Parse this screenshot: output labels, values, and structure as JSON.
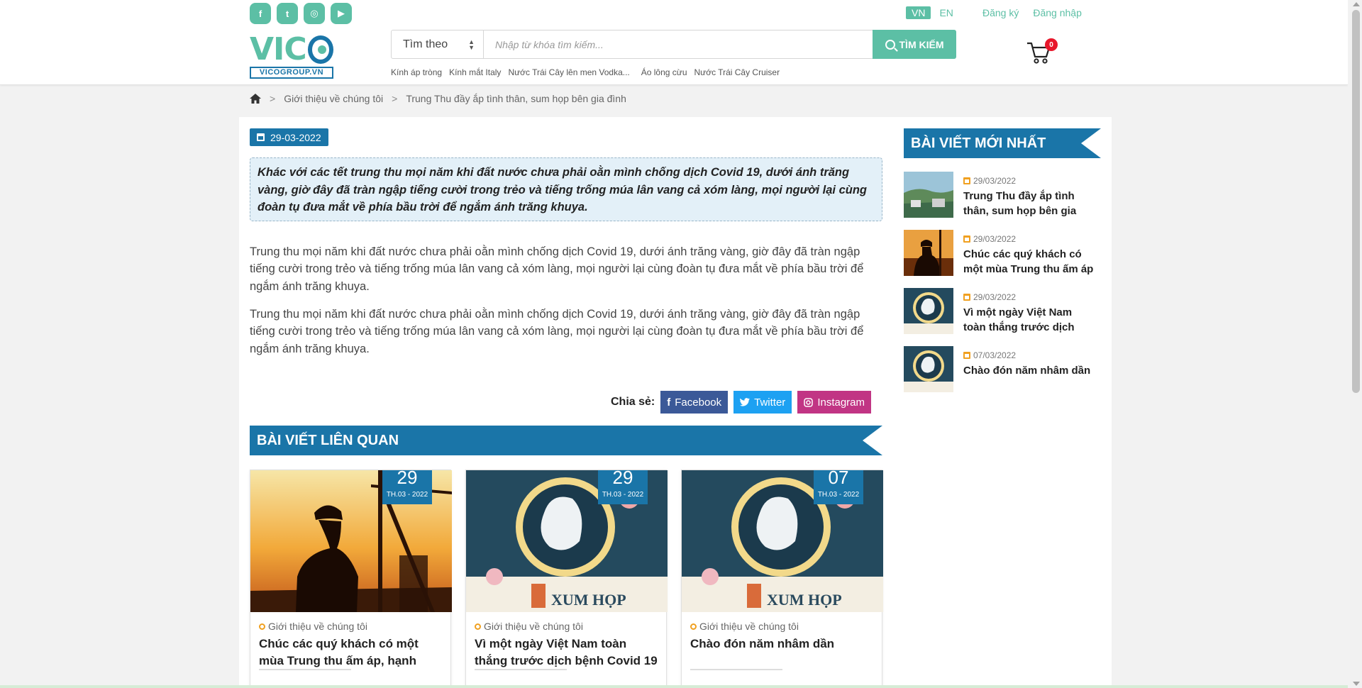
{
  "header": {
    "socials": [
      {
        "name": "facebook-icon",
        "glyph": "f"
      },
      {
        "name": "twitter-icon",
        "glyph": "t"
      },
      {
        "name": "instagram-icon",
        "glyph": "◎"
      },
      {
        "name": "youtube-icon",
        "glyph": "▶"
      }
    ],
    "logo_word": "VIC",
    "logo_sub": "VICOGROUP.VN",
    "search": {
      "select_label": "Tìm theo",
      "placeholder": "Nhập từ khóa tìm kiếm...",
      "button_label": "TÌM KIẾM"
    },
    "keywords": [
      "Kính áp tròng",
      "Kính mắt Italy",
      "Nước Trái Cây lên men Vodka...",
      "Áo lông cừu",
      "Nước Trái Cây Cruiser"
    ],
    "lang": {
      "vn": "VN",
      "en": "EN"
    },
    "auth": {
      "register": "Đăng ký",
      "login": "Đăng nhập"
    },
    "cart_count": "0"
  },
  "breadcrumb": {
    "sep": ">",
    "items": [
      "Giới thiệu về chúng tôi",
      "Trung Thu đầy ắp tình thân, sum họp bên gia đình"
    ]
  },
  "article": {
    "date": "29-03-2022",
    "intro": "Khác với các tết trung thu mọi năm khi đất nước chưa phải oằn mình chống dịch Covid 19, dưới ánh trăng vàng, giờ đây đã tràn ngập tiếng cười trong trẻo và tiếng trống múa lân vang cả xóm làng, mọi người lại cùng đoàn tụ đưa mắt về phía bầu trời để ngắm ánh trăng khuya.",
    "paragraphs": [
      "Trung thu mọi năm khi đất nước chưa phải oằn mình chống dịch Covid 19, dưới ánh trăng vàng, giờ đây đã tràn ngập tiếng cười trong trẻo và tiếng trống múa lân vang cả xóm làng, mọi người lại cùng đoàn tụ đưa mắt về phía bầu trời để ngắm ánh trăng khuya.",
      "Trung thu mọi năm khi đất nước chưa phải oằn mình chống dịch Covid 19, dưới ánh trăng vàng, giờ đây đã tràn ngập tiếng cười trong trẻo và tiếng trống múa lân vang cả xóm làng, mọi người lại cùng đoàn tụ đưa mắt về phía bầu trời để ngắm ánh trăng khuya."
    ],
    "share": {
      "label": "Chia sẻ:",
      "facebook": "Facebook",
      "twitter": "Twitter",
      "instagram": "Instagram"
    }
  },
  "related": {
    "heading": "BÀI VIẾT LIÊN QUAN",
    "cards": [
      {
        "day": "29",
        "month": "TH.03 - 2022",
        "category": "Giới thiệu về chúng tôi",
        "title": "Chúc các quý khách có một mùa Trung thu ấm áp, hạnh phúc"
      },
      {
        "day": "29",
        "month": "TH.03 - 2022",
        "category": "Giới thiệu về chúng tôi",
        "title": "Vì một ngày Việt Nam toàn thắng trước dịch bệnh Covid 19"
      },
      {
        "day": "07",
        "month": "TH.03 - 2022",
        "category": "Giới thiệu về chúng tôi",
        "title": "Chào đón năm nhâm dần"
      }
    ]
  },
  "latest": {
    "heading": "BÀI VIẾT MỚI NHẤT",
    "items": [
      {
        "date": "29/03/2022",
        "title": "Trung Thu đầy ắp tình thân, sum họp bên gia đình"
      },
      {
        "date": "29/03/2022",
        "title": "Chúc các quý khách có một mùa Trung thu ấm áp"
      },
      {
        "date": "29/03/2022",
        "title": "Vì một ngày Việt Nam toàn thắng trước dịch bệnh"
      },
      {
        "date": "07/03/2022",
        "title": "Chào đón năm nhâm dần"
      }
    ]
  },
  "colors": {
    "accent": "#5cbfa5",
    "brand_blue": "#1a75a8",
    "badge_red": "#e8172b",
    "facebook": "#3b5998",
    "twitter": "#1da1f2",
    "instagram": "#c13584"
  }
}
